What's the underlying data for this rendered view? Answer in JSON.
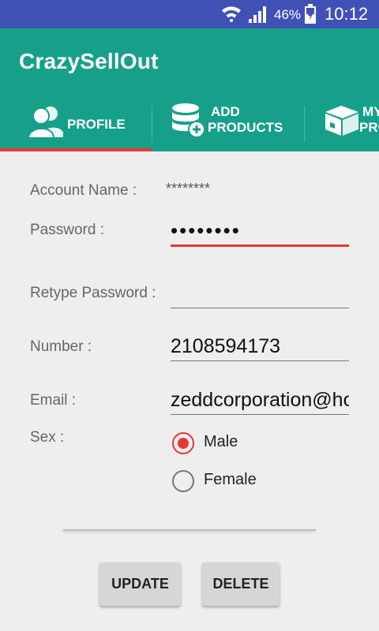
{
  "status_bar": {
    "battery": "46%",
    "time": "10:12"
  },
  "app": {
    "title": "CrazySellOut"
  },
  "tabs": [
    {
      "label": "PROFILE",
      "icon": "profile-icon"
    },
    {
      "line1": "ADD",
      "line2": "PRODUCTS",
      "icon": "add-products-icon"
    },
    {
      "line1": "MY",
      "line2": "PRODUCTS",
      "icon": "box-icon"
    }
  ],
  "form": {
    "account_name": {
      "label": "Account Name :",
      "value": "********"
    },
    "password": {
      "label": "Password :",
      "value": "••••••••"
    },
    "retype_password": {
      "label": "Retype Password :",
      "value": ""
    },
    "number": {
      "label": "Number :",
      "value": "2108594173"
    },
    "email": {
      "label": "Email :",
      "value": "zeddcorporation@hotmail.com"
    },
    "sex": {
      "label": "Sex :",
      "options": [
        "Male",
        "Female"
      ],
      "selected": "Male"
    }
  },
  "buttons": {
    "update": "UPDATE",
    "delete": "DELETE"
  },
  "colors": {
    "status_bar": "#3f51b5",
    "app_bar": "#16a08a",
    "accent": "#e53935"
  }
}
